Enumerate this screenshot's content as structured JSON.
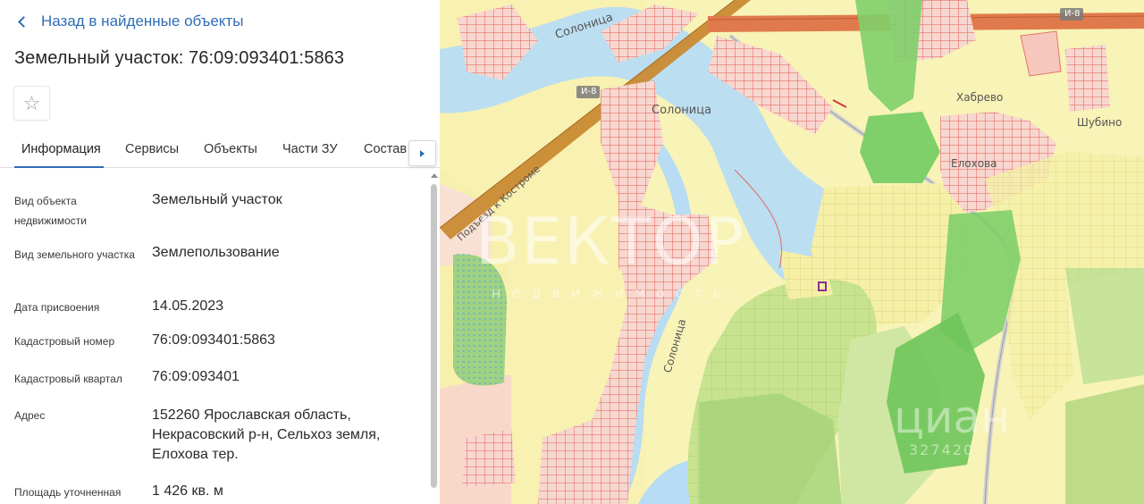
{
  "panel": {
    "back_label": "Назад в найденные объекты",
    "title": "Земельный участок: 76:09:093401:5863"
  },
  "tabs": [
    {
      "label": "Информация",
      "active": true
    },
    {
      "label": "Сервисы"
    },
    {
      "label": "Объекты"
    },
    {
      "label": "Части ЗУ"
    },
    {
      "label": "Состав"
    }
  ],
  "rows": [
    {
      "label": "Вид объекта недвижимости",
      "value": "Земельный участок"
    },
    {
      "label": "Вид земельного участка",
      "value": "Землепользование"
    },
    {
      "label": "Дата присвоения",
      "value": "14.05.2023"
    },
    {
      "label": "Кадастровый номер",
      "value": "76:09:093401:5863"
    },
    {
      "label": "Кадастровый квартал",
      "value": "76:09:093401"
    },
    {
      "label": "Адрес",
      "value": "152260 Ярославская область, Некрасовский р-н, Сельхоз земля, Елохова тер."
    },
    {
      "label": "Площадь уточненная",
      "value": "1 426 кв. м"
    }
  ],
  "map": {
    "labels": {
      "river_top": "Солоница",
      "river_mid": "Солоница",
      "river_vertical": "Солоница",
      "road_shield_left": "И-8",
      "road_shield_right": "И-8",
      "village_1": "Хабрево",
      "village_2": "Шубино",
      "village_3": "Елохова",
      "road_name": "Подъезд к Костроме"
    },
    "watermarks": {
      "vektor": "ВЕКТОР",
      "vektor_sub": "недвижимость",
      "cian": "циан",
      "cian_num": "327420"
    },
    "colors": {
      "land": "#f8f3b6",
      "water": "#b7dcf4",
      "forest": "#cfe7a3",
      "dense_forest": "#7fcf6a",
      "parcels": "#f2b7ad",
      "road": "#c98a33",
      "accent": "#2f6db6"
    }
  }
}
